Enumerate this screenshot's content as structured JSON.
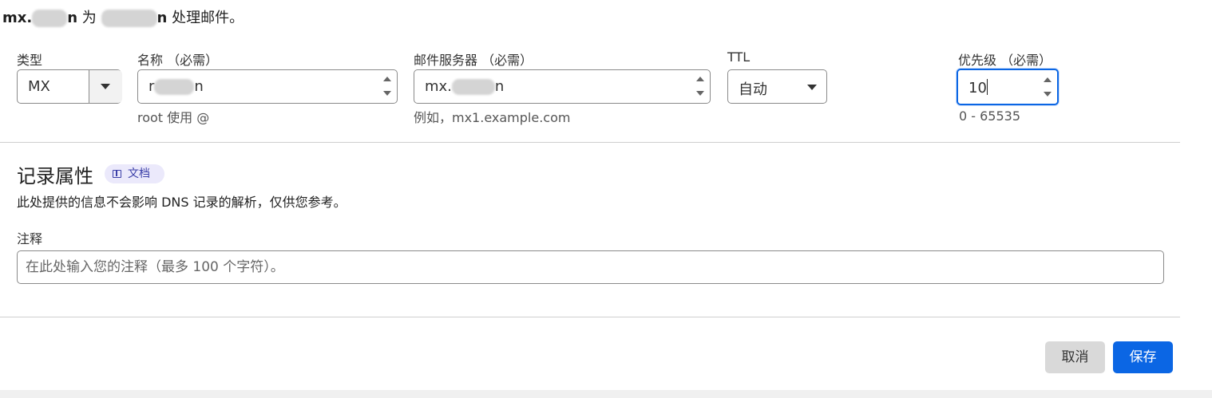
{
  "header": {
    "prefix": "mx.",
    "suffix": "n",
    "for_text": "为",
    "target_suffix": "n",
    "handles_text": "处理邮件。"
  },
  "fields": {
    "type": {
      "label": "类型",
      "value": "MX"
    },
    "name": {
      "label": "名称 （必需）",
      "value_start": "r",
      "value_end": "n",
      "hint": "root 使用 @"
    },
    "mail_server": {
      "label": "邮件服务器 （必需）",
      "value_start": "mx.",
      "value_end": "n",
      "hint": "例如，mx1.example.com"
    },
    "ttl": {
      "label": "TTL",
      "value": "自动"
    },
    "priority": {
      "label": "优先级 （必需）",
      "value": "10",
      "hint": "0 - 65535",
      "focus_color": "#0b66e4"
    }
  },
  "record_attributes": {
    "title": "记录属性",
    "doc_badge": "文档",
    "description": "此处提供的信息不会影响 DNS 记录的解析，仅供您参考。",
    "note_label": "注释",
    "note_placeholder": "在此处输入您的注释（最多 100 个字符）。"
  },
  "actions": {
    "cancel": "取消",
    "save": "保存",
    "save_color": "#0b66e4"
  },
  "icons": {
    "doc_badge_icon": "book-icon",
    "select_caret": "chevron-down-icon",
    "spinner": "spinner-arrows-icon"
  }
}
